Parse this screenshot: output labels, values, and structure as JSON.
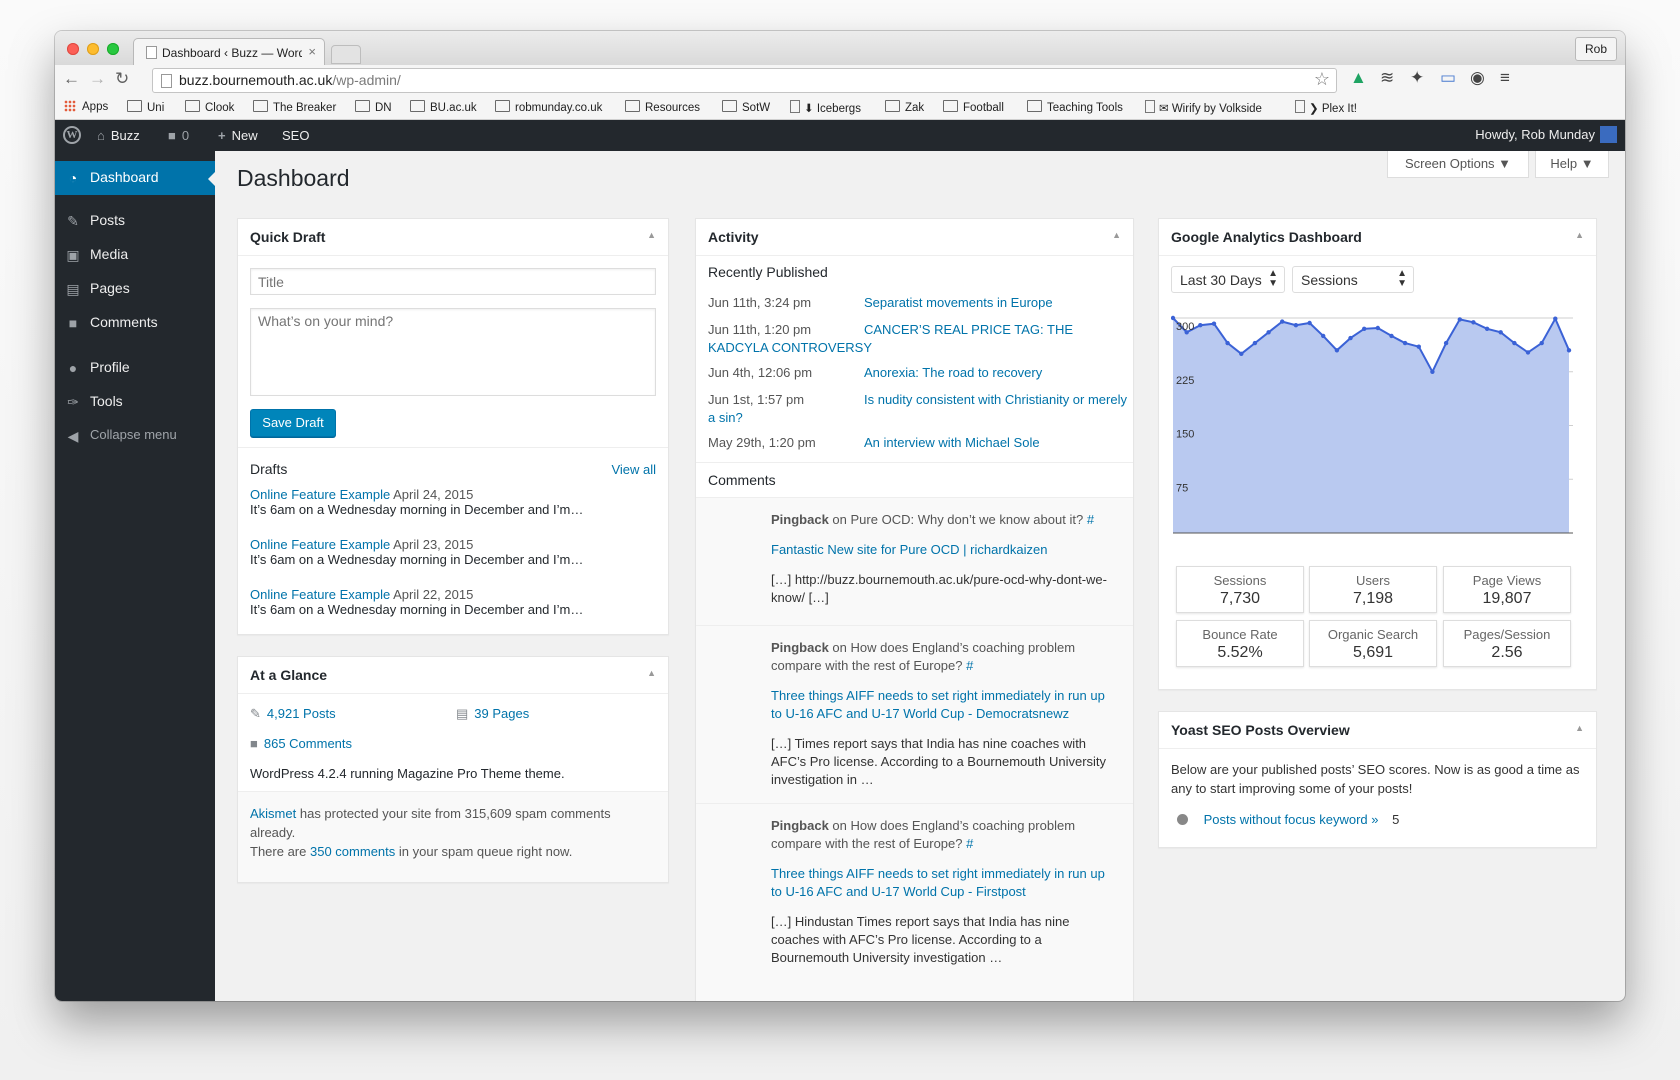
{
  "browser": {
    "tab_title": "Dashboard ‹ Buzz — Word",
    "tab_close": "×",
    "profile_button": "Rob",
    "url_host": "buzz.bournemouth.ac.uk",
    "url_path": "/wp-admin/",
    "bookmarks": [
      "Apps",
      "Uni",
      "Clook",
      "The Breaker",
      "DN",
      "BU.ac.uk",
      "robmunday.co.uk",
      "Resources",
      "SotW",
      "⬇ Icebergs",
      "Zak",
      "Football",
      "Teaching Tools",
      "✉ Wirify by Volkside",
      "❯ Plex It!"
    ]
  },
  "adminbar": {
    "site_name": "Buzz",
    "comment_count": "0",
    "new_label": "New",
    "seo_label": "SEO",
    "howdy": "Howdy, Rob Munday"
  },
  "sidebar": {
    "items": [
      {
        "label": "Dashboard",
        "icon": "dashboard-icon"
      },
      {
        "label": "Posts",
        "icon": "pushpin-icon"
      },
      {
        "label": "Media",
        "icon": "media-icon"
      },
      {
        "label": "Pages",
        "icon": "pages-icon"
      },
      {
        "label": "Comments",
        "icon": "comments-icon"
      },
      {
        "label": "Profile",
        "icon": "user-icon"
      },
      {
        "label": "Tools",
        "icon": "wrench-icon"
      },
      {
        "label": "Collapse menu",
        "icon": "collapse-icon"
      }
    ]
  },
  "page": {
    "title": "Dashboard",
    "screen_options": "Screen Options ▼",
    "help": "Help ▼"
  },
  "quick_draft": {
    "title": "Quick Draft",
    "title_placeholder": "Title",
    "body_placeholder": "What’s on your mind?",
    "save_label": "Save Draft",
    "drafts_label": "Drafts",
    "view_all": "View all",
    "drafts": [
      {
        "title": "Online Feature Example",
        "date": "April 24, 2015",
        "excerpt": "It’s 6am on a Wednesday morning in December and I’m…"
      },
      {
        "title": "Online Feature Example",
        "date": "April 23, 2015",
        "excerpt": "It’s 6am on a Wednesday morning in December and I’m…"
      },
      {
        "title": "Online Feature Example",
        "date": "April 22, 2015",
        "excerpt": "It’s 6am on a Wednesday morning in December and I’m…"
      }
    ]
  },
  "at_a_glance": {
    "title": "At a Glance",
    "posts": "4,921 Posts",
    "pages": "39 Pages",
    "comments": "865 Comments",
    "version": "WordPress 4.2.4 running Magazine Pro Theme theme.",
    "akismet_link": "Akismet",
    "akismet_text": "has protected your site from 315,609 spam comments already.",
    "spam_pre": "There are",
    "spam_link": "350 comments",
    "spam_post": "in your spam queue right now."
  },
  "activity": {
    "title": "Activity",
    "recently_published": "Recently Published",
    "posts": [
      {
        "date": "Jun 11th, 3:24 pm",
        "title": "Separatist movements in Europe"
      },
      {
        "date": "Jun 11th, 1:20 pm",
        "title": "CANCER’S REAL PRICE TAG: THE KADCYLA CONTROVERSY"
      },
      {
        "date": "Jun 4th, 12:06 pm",
        "title": "Anorexia: The road to recovery"
      },
      {
        "date": "Jun 1st, 1:57 pm",
        "title": "Is nudity consistent with Christianity or merely a sin?"
      },
      {
        "date": "May 29th, 1:20 pm",
        "title": "An interview with Michael Sole"
      }
    ],
    "comments_label": "Comments",
    "comments": [
      {
        "type": "Pingback",
        "on": "on",
        "target": "Pure OCD: Why don’t we know about it?",
        "hash": "#",
        "source": "Fantastic New site for Pure OCD | richardkaizen",
        "excerpt": "[…] http://buzz.bournemouth.ac.uk/pure-ocd-why-dont-we-know/ […]"
      },
      {
        "type": "Pingback",
        "on": "on",
        "target": "How does England’s coaching problem compare with the rest of Europe?",
        "hash": "#",
        "source": "Three things AIFF needs to set right immediately in run up to U-16 AFC and U-17 World Cup - Democratsnewz",
        "excerpt": "[…] Times report says that India has nine coaches with AFC’s Pro license. According to a Bournemouth University investigation in …"
      },
      {
        "type": "Pingback",
        "on": "on",
        "target": "How does England’s coaching problem compare with the rest of Europe?",
        "hash": "#",
        "source": "Three things AIFF needs to set right immediately in run up to U-16 AFC and U-17 World Cup - Firstpost",
        "excerpt": "[…] Hindustan Times report says that India has nine coaches with AFC’s Pro license. According to a Bournemouth University investigation …"
      }
    ]
  },
  "analytics": {
    "title": "Google Analytics Dashboard",
    "range_select": "Last 30 Days",
    "metric_select": "Sessions",
    "stats": [
      {
        "label": "Sessions",
        "value": "7,730"
      },
      {
        "label": "Users",
        "value": "7,198"
      },
      {
        "label": "Page Views",
        "value": "19,807"
      },
      {
        "label": "Bounce Rate",
        "value": "5.52%"
      },
      {
        "label": "Organic Search",
        "value": "5,691"
      },
      {
        "label": "Pages/Session",
        "value": "2.56"
      }
    ],
    "colors": {
      "fill": "#b9c9f0",
      "line": "#3b62d6"
    }
  },
  "chart_data": {
    "type": "area",
    "y_ticks": [
      "300",
      "225",
      "150",
      "75"
    ],
    "ylim": [
      0,
      300
    ],
    "grid": true,
    "values": [
      300,
      280,
      290,
      292,
      265,
      250,
      265,
      280,
      295,
      290,
      293,
      275,
      255,
      272,
      285,
      286,
      275,
      265,
      260,
      225,
      265,
      298,
      294,
      285,
      280,
      265,
      252,
      265,
      299,
      255
    ]
  },
  "yoast": {
    "title": "Yoast SEO Posts Overview",
    "intro": "Below are your published posts’ SEO scores. Now is as good a time as any to start improving some of your posts!",
    "row_label": "Posts without focus keyword »",
    "row_count": "5"
  }
}
